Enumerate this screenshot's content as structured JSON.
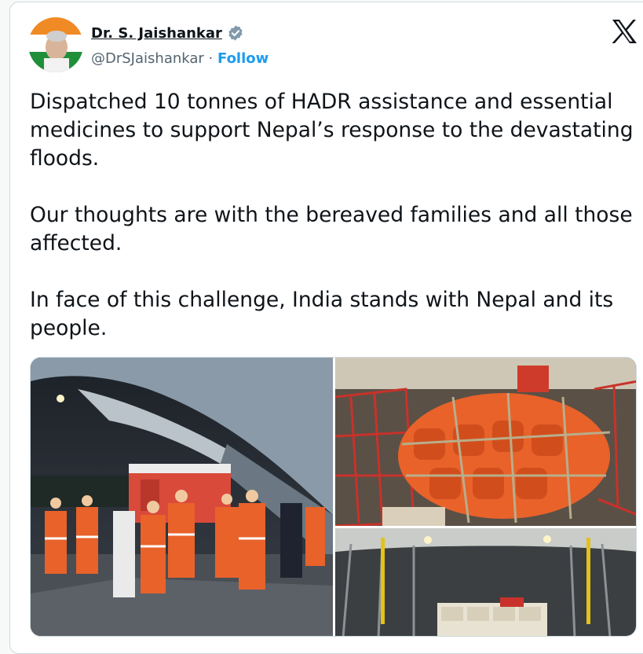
{
  "author": {
    "name": "Dr. S. Jaishankar",
    "handle": "@DrSJaishankar",
    "separator": "·",
    "follow_label": "Follow"
  },
  "icons": {
    "verified": "verified-badge-icon",
    "platform": "x-logo-icon"
  },
  "tweet": {
    "paragraphs": [
      "Dispatched 10 tonnes of HADR assistance and essential medicines to support Nepal’s response to the devastating floods.",
      "Our thoughts are with the bereaved families and all those affected.",
      "In face of this challenge, India stands with Nepal and its people."
    ]
  },
  "colors": {
    "accent": "#1d9bf0",
    "text": "#0f1419",
    "secondary": "#536471",
    "ndrf_orange": "#e8622a"
  }
}
